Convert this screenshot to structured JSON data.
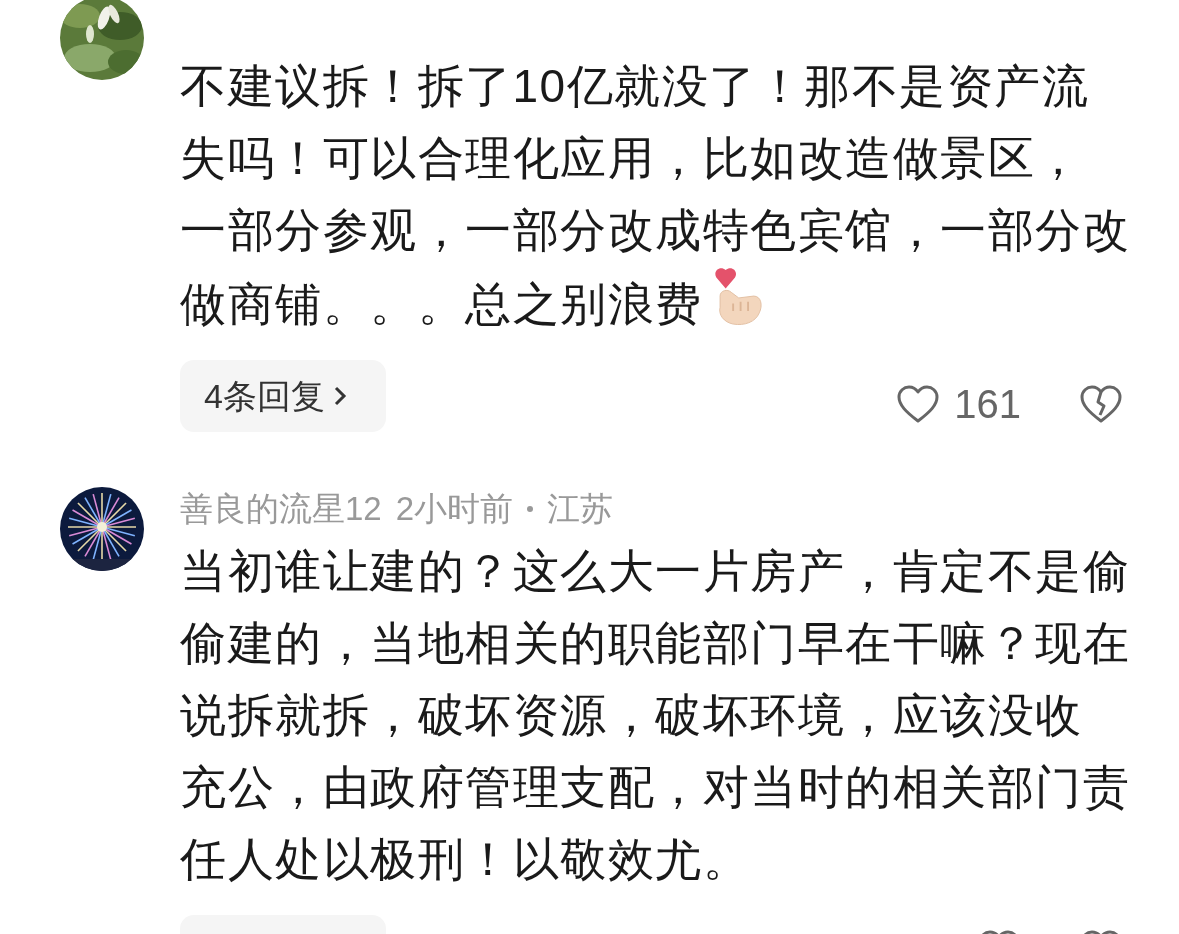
{
  "comments": [
    {
      "avatar": {
        "kind": "picture"
      },
      "lines": [
        "不建议拆！拆了10亿就没了！那不是资产流",
        "失吗！可以合理化应用，比如改造做景区，",
        "一部分参观，一部分改成特色宾馆，一部分改",
        "做商铺。。。总之别浪费"
      ],
      "emoji": true,
      "replies": "4条回复",
      "likes": "161"
    },
    {
      "avatar": {
        "kind": "picture"
      },
      "author": "善良的流星12",
      "time": "2小时前",
      "location": "江苏",
      "lines": [
        "当初谁让建的？这么大一片房产，肯定不是偷",
        "偷建的，当地相关的职能部门早在干嘛？现在",
        "说拆就拆，破坏资源，破坏环境，应该没收",
        "充公，由政府管理支配，对当时的相关部门责",
        "任人处以极刑！以敬效尤。"
      ]
    }
  ]
}
